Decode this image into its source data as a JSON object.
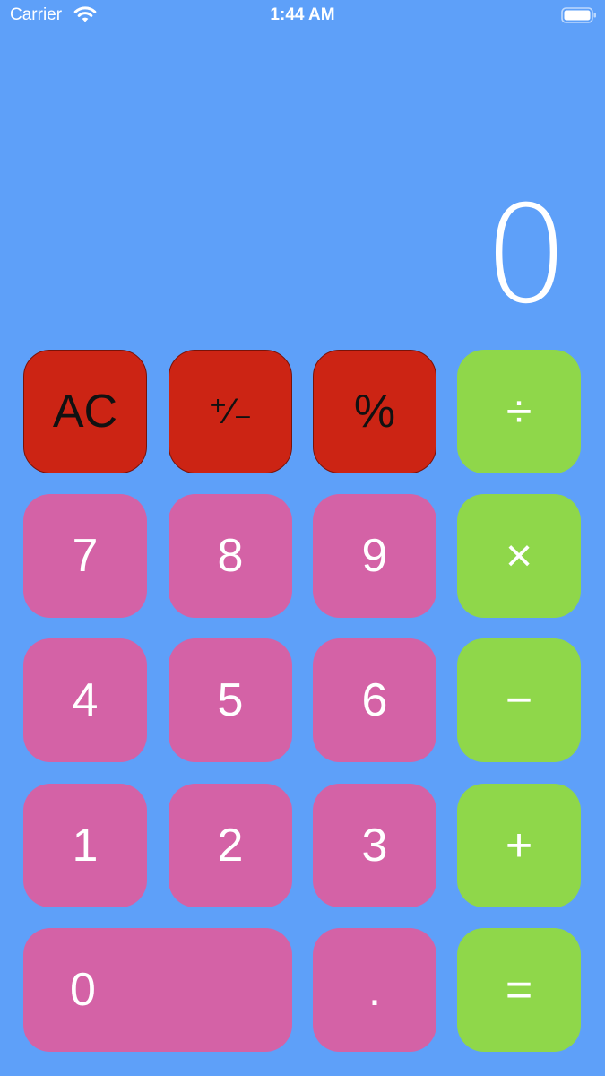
{
  "status_bar": {
    "carrier": "Carrier",
    "time": "1:44 AM"
  },
  "display": {
    "value": "0"
  },
  "keys": {
    "ac": "AC",
    "sign": "⁺∕₋",
    "percent": "%",
    "divide": "÷",
    "seven": "7",
    "eight": "8",
    "nine": "9",
    "multiply": "×",
    "four": "4",
    "five": "5",
    "six": "6",
    "minus": "−",
    "one": "1",
    "two": "2",
    "three": "3",
    "plus": "+",
    "zero": "0",
    "decimal": ".",
    "equals": "="
  },
  "colors": {
    "background": "#5ea0f9",
    "function_key": "#cc2414",
    "number_key": "#d462a6",
    "operator_key": "#8fd74a"
  },
  "icons": [
    "wifi-icon",
    "battery-icon"
  ]
}
